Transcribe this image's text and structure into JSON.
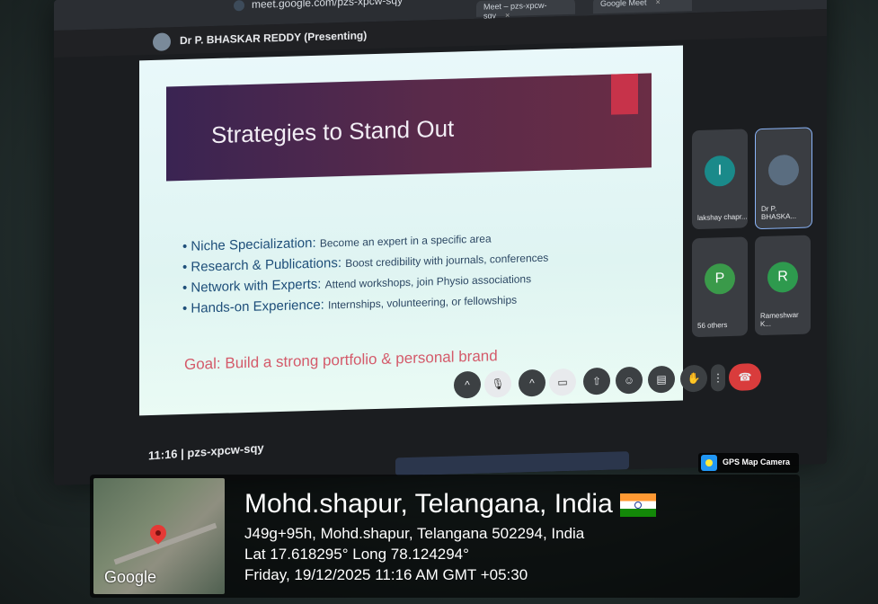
{
  "browser": {
    "url": "meet.google.com/pzs-xpcw-sqy",
    "tabs": [
      "Meet – pzs-xpcw-sqy",
      "Google Meet"
    ]
  },
  "meet": {
    "presenter": "Dr P. BHASKAR REDDY (Presenting)",
    "meeting_code": "11:16 | pzs-xpcw-sqy",
    "participants": [
      {
        "initial": "I",
        "name": "lakshay chapr...",
        "color": "#1a8a8a"
      },
      {
        "initial": "",
        "name": "Dr P. BHASKA...",
        "color": "#5a6d80"
      },
      {
        "initial": "P",
        "name": "56 others",
        "color": "#3a9a4a"
      },
      {
        "initial": "R",
        "name": "Rameshwar K...",
        "color": "#2e9a4e"
      }
    ]
  },
  "slide": {
    "title": "Strategies to Stand Out",
    "bullets": [
      {
        "head": "Niche Specialization:",
        "desc": "Become an expert in a specific area"
      },
      {
        "head": "Research & Publications:",
        "desc": "Boost credibility with journals, conferences"
      },
      {
        "head": "Network with Experts:",
        "desc": "Attend workshops, join Physio associations"
      },
      {
        "head": "Hands-on Experience:",
        "desc": "Internships, volunteering, or fellowships"
      }
    ],
    "goal": "Goal: Build a strong portfolio & personal brand"
  },
  "overlay": {
    "badge": "GPS Map Camera",
    "map_label": "Google",
    "location": "Mohd.shapur, Telangana, India",
    "address": "J49g+95h, Mohd.shapur, Telangana 502294, India",
    "coords": "Lat 17.618295° Long 78.124294°",
    "datetime": "Friday, 19/12/2025 11:16 AM GMT +05:30"
  },
  "colors": {
    "end_call": "#d93c3c",
    "pin": "#e53935"
  }
}
